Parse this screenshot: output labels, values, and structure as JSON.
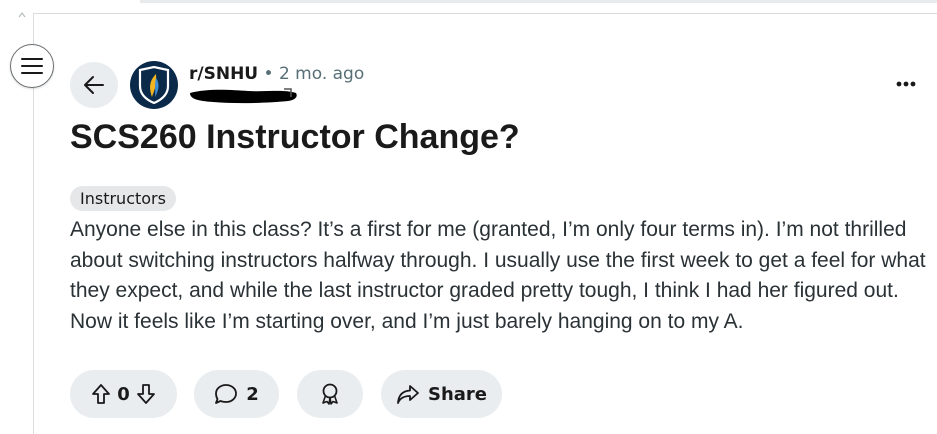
{
  "post": {
    "subreddit": "r/SNHU",
    "separator": "•",
    "age": "2 mo. ago",
    "title": "SCS260 Instructor Change?",
    "flair": "Instructors",
    "body": "Anyone else in this class? It’s a first for me (granted, I’m only four terms in). I’m not thrilled about switching instructors halfway through. I usually use the first week to get a feel for what they expect, and while the last instructor graded pretty tough, I think I had her figured out. Now it feels like I’m starting over, and I’m just barely hanging on to my A."
  },
  "actions": {
    "vote_count": "0",
    "comment_count": "2",
    "share_label": "Share"
  },
  "icons": {
    "menu": "hamburger-menu-icon",
    "back": "arrow-left-icon",
    "avatar": "subreddit-shield-logo",
    "more": "ellipsis-icon",
    "upvote": "arrow-up-icon",
    "downvote": "arrow-down-icon",
    "comment": "speech-bubble-icon",
    "award": "award-ribbon-icon",
    "share": "share-arrow-icon"
  },
  "colors": {
    "avatar_bg": "#0b2a4a",
    "pill_bg": "#eaedef",
    "meta_text": "#576f76"
  }
}
